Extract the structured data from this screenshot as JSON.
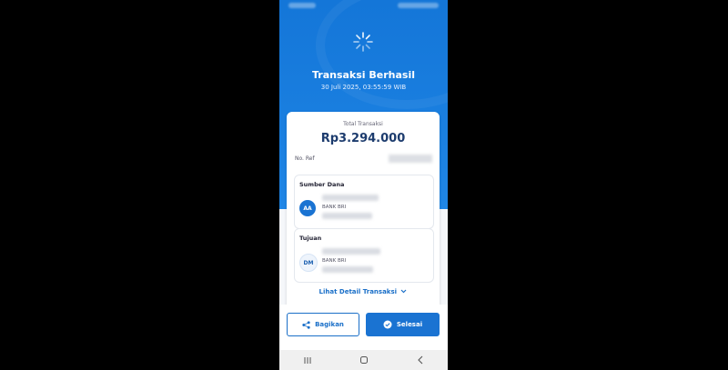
{
  "header": {
    "title": "Transaksi Berhasil",
    "datetime": "30 Juli 2025, 03:55:59 WIB"
  },
  "summary": {
    "total_label": "Total Transaksi",
    "total_amount": "Rp3.294.000",
    "ref_label": "No. Ref"
  },
  "source": {
    "title": "Sumber Dana",
    "initials": "AA",
    "bank": "BANK BRI"
  },
  "destination": {
    "title": "Tujuan",
    "initials": "DM",
    "bank": "BANK BRI"
  },
  "detail_link": "Lihat Detail Transaksi",
  "actions": {
    "share_label": "Bagikan",
    "done_label": "Selesai"
  },
  "nav": {
    "recent_icon": "recent-apps-icon",
    "home_icon": "home-icon",
    "back_icon": "back-icon"
  },
  "colors": {
    "primary": "#1a73d2",
    "header": "#1476d8",
    "amount": "#1d3c6e"
  }
}
